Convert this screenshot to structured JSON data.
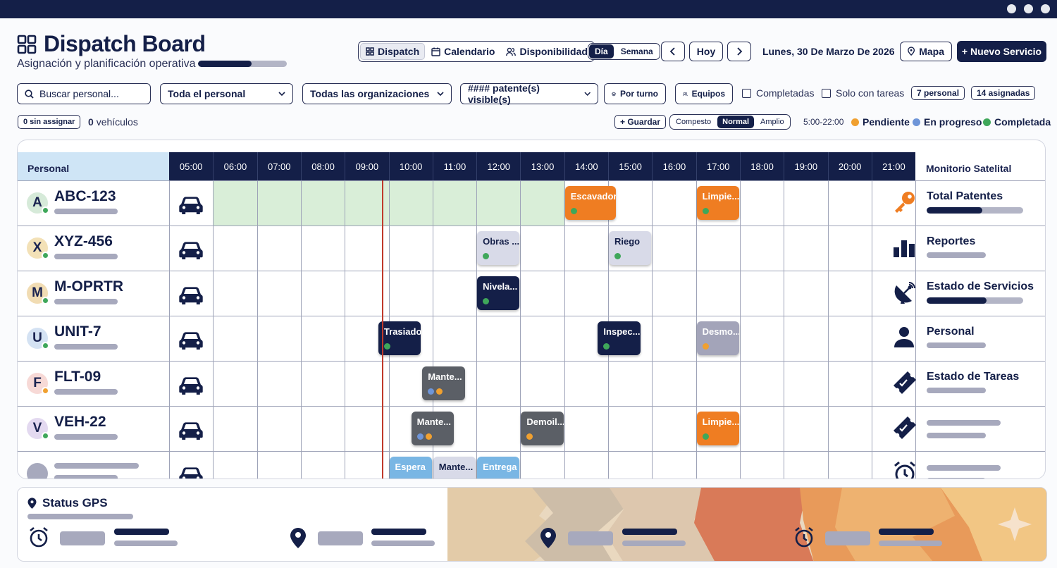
{
  "app": {
    "title": "Dispatch Board",
    "subtitle": "Asignación y planificación operativa",
    "progress": 0.6
  },
  "views": [
    "Dispatch",
    "Calendario",
    "Disponibilidad"
  ],
  "mode": [
    "Día",
    "Semana"
  ],
  "nav": {
    "today": "Hoy",
    "date": "Lunes, 30 De Marzo De 2026",
    "map": "Mapa",
    "new_service": "+ Nuevo Servicio"
  },
  "filters": {
    "search_placeholder": "Buscar personal...",
    "personnel": "Toda el personal",
    "orgs": "Todas las organizaciones",
    "plates": "#### patente(s) visible(s)",
    "by_shift": "Por turno",
    "teams": "Equipos",
    "completed": "Completadas",
    "only_tasks": "Solo con tareas",
    "count_personnel": "7 personal",
    "count_assigned": "14 asignadas"
  },
  "row2": {
    "unassigned": "0 sin assignar",
    "vehicles_count": "0",
    "vehicles_label": "vehículos",
    "save": "+ Guardar",
    "density": [
      "Compesto",
      "Normal",
      "Amplio"
    ],
    "range": "5:00-22:00"
  },
  "legend": [
    {
      "label": "Pendiente",
      "color": "#f0a030"
    },
    {
      "label": "En progreso",
      "color": "#6e95d8"
    },
    {
      "label": "Completada",
      "color": "#3fa75a"
    }
  ],
  "board": {
    "personal_header": "Personal",
    "monitor_header": "Monitorio Satelital",
    "times": [
      "05:00",
      "06:00",
      "07:00",
      "08:00",
      "09:00",
      "10:00",
      "11:00",
      "12:00",
      "13:00",
      "14:00",
      "15:00",
      "16:00",
      "17:00",
      "18:00",
      "19:00",
      "20:00",
      "21:00"
    ],
    "rows": [
      {
        "letter": "A",
        "plate": "ABC-123",
        "avatar_bg": "#d6ead9",
        "status": "#3fa75a"
      },
      {
        "letter": "X",
        "plate": "XYZ-456",
        "avatar_bg": "#f3e1b7",
        "status": "#3fa75a"
      },
      {
        "letter": "M",
        "plate": "M-OPRTR",
        "avatar_bg": "#f1dcb3",
        "status": "#3fa75a"
      },
      {
        "letter": "U",
        "plate": "UNIT-7",
        "avatar_bg": "#d4e2f3",
        "status": "#3fa75a"
      },
      {
        "letter": "F",
        "plate": "FLT-09",
        "avatar_bg": "#f7d9d6",
        "status": "#f0a030"
      },
      {
        "letter": "V",
        "plate": "VEH-22",
        "avatar_bg": "#e3d9f0",
        "status": "#3fa75a"
      }
    ],
    "events": [
      {
        "label": "Escavadora",
        "row": 0,
        "start": 14.0,
        "end": 15.2,
        "style": "orange",
        "dots": [
          "#3fa75a"
        ]
      },
      {
        "label": "Limpie...",
        "row": 0,
        "start": 17.0,
        "end": 18.0,
        "style": "orange",
        "dots": [
          "#3fa75a"
        ]
      },
      {
        "label": "Obras ...",
        "row": 1,
        "start": 12.0,
        "end": 13.0,
        "style": "light",
        "dots": [
          "#3fa75a"
        ]
      },
      {
        "label": "Riego",
        "row": 1,
        "start": 15.0,
        "end": 16.0,
        "style": "light",
        "dots": [
          "#3fa75a"
        ]
      },
      {
        "label": "Nivela...",
        "row": 2,
        "start": 12.0,
        "end": 13.0,
        "style": "navy",
        "dots": [
          "#3fa75a"
        ]
      },
      {
        "label": "Trasiado",
        "row": 3,
        "start": 9.75,
        "end": 10.75,
        "style": "navy",
        "dots": [
          "#3fa75a"
        ]
      },
      {
        "label": "Inspec...",
        "row": 3,
        "start": 14.75,
        "end": 15.75,
        "style": "navy",
        "dots": [
          "#3fa75a"
        ]
      },
      {
        "label": "Desmo...",
        "row": 3,
        "start": 17.0,
        "end": 18.0,
        "style": "grey",
        "dots": [
          "#f0a030"
        ]
      },
      {
        "label": "Mante...",
        "row": 4,
        "start": 10.75,
        "end": 11.75,
        "style": "dgrey",
        "dots": [
          "#6e95d8",
          "#f0a030"
        ]
      },
      {
        "label": "Mante...",
        "row": 5,
        "start": 10.5,
        "end": 11.5,
        "style": "dgrey",
        "dots": [
          "#6e95d8",
          "#f0a030"
        ]
      },
      {
        "label": "Demoil...",
        "row": 5,
        "start": 13.0,
        "end": 14.0,
        "style": "dgrey",
        "dots": [
          "#f0a030"
        ]
      },
      {
        "label": "Limpie...",
        "row": 5,
        "start": 17.0,
        "end": 18.0,
        "style": "orange",
        "dots": [
          "#3fa75a"
        ]
      },
      {
        "label": "Espera",
        "row": 6,
        "start": 10.0,
        "end": 11.0,
        "style": "blue",
        "dots": [
          "#3fa75a"
        ]
      },
      {
        "label": "Mante...",
        "row": 6,
        "start": 11.0,
        "end": 12.0,
        "style": "light",
        "dots": [
          "#6e95d8",
          "#f0a030"
        ]
      },
      {
        "label": "Entrega",
        "row": 6,
        "start": 12.0,
        "end": 13.0,
        "style": "blue",
        "dots": [
          "#3fa75a",
          "#f0a030"
        ]
      }
    ],
    "highlight": {
      "row": 0,
      "start": 6,
      "end": 14
    },
    "now_time": 9.85,
    "monitor": [
      {
        "label": "Total Patentes",
        "icon": "key-icon",
        "progress": 0.58
      },
      {
        "label": "Reportes",
        "icon": "bar-chart-icon"
      },
      {
        "label": "Estado de Servicios",
        "icon": "satellite-icon",
        "progress": 0.62
      },
      {
        "label": "Personal",
        "icon": "person-icon"
      },
      {
        "label": "Estado de Tareas",
        "icon": "ticket-icon"
      },
      {
        "label": "",
        "icon": "ticket-check-icon"
      },
      {
        "label": "",
        "icon": "alarm-icon"
      }
    ]
  },
  "gps": {
    "title": "Status GPS"
  }
}
